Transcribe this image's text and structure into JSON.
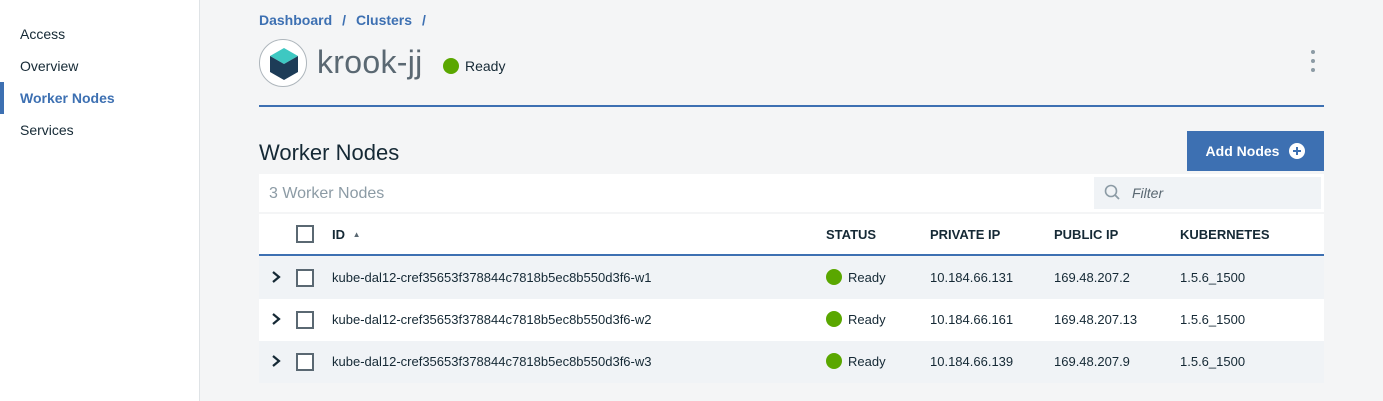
{
  "sidebar": {
    "items": [
      {
        "label": "Access"
      },
      {
        "label": "Overview"
      },
      {
        "label": "Worker Nodes",
        "active": true
      },
      {
        "label": "Services"
      }
    ]
  },
  "breadcrumb": {
    "items": [
      "Dashboard",
      "Clusters"
    ],
    "separator": "/"
  },
  "cluster": {
    "name": "krook-jj",
    "status": "Ready",
    "status_color": "#5aa700"
  },
  "section": {
    "title": "Worker Nodes",
    "add_button": "Add Nodes"
  },
  "table": {
    "count_label": "3 Worker Nodes",
    "filter_placeholder": "Filter",
    "columns": [
      "ID",
      "STATUS",
      "PRIVATE IP",
      "PUBLIC IP",
      "KUBERNETES"
    ],
    "sort_indicator": "▲",
    "rows": [
      {
        "id": "kube-dal12-cref35653f378844c7818b5ec8b550d3f6-w1",
        "status": "Ready",
        "private_ip": "10.184.66.131",
        "public_ip": "169.48.207.2",
        "kubernetes": "1.5.6_1500"
      },
      {
        "id": "kube-dal12-cref35653f378844c7818b5ec8b550d3f6-w2",
        "status": "Ready",
        "private_ip": "10.184.66.161",
        "public_ip": "169.48.207.13",
        "kubernetes": "1.5.6_1500"
      },
      {
        "id": "kube-dal12-cref35653f378844c7818b5ec8b550d3f6-w3",
        "status": "Ready",
        "private_ip": "10.184.66.139",
        "public_ip": "169.48.207.9",
        "kubernetes": "1.5.6_1500"
      }
    ]
  },
  "colors": {
    "accent": "#3d70b2",
    "ready": "#5aa700",
    "logo_teal": "#3ec8c2",
    "logo_dark": "#1d3c57"
  },
  "icons": {
    "cluster_logo": "cluster-cube-icon",
    "kebab": "overflow-menu-icon",
    "add": "add-circle-icon",
    "filter": "search-icon",
    "expand": "chevron-right-icon"
  }
}
